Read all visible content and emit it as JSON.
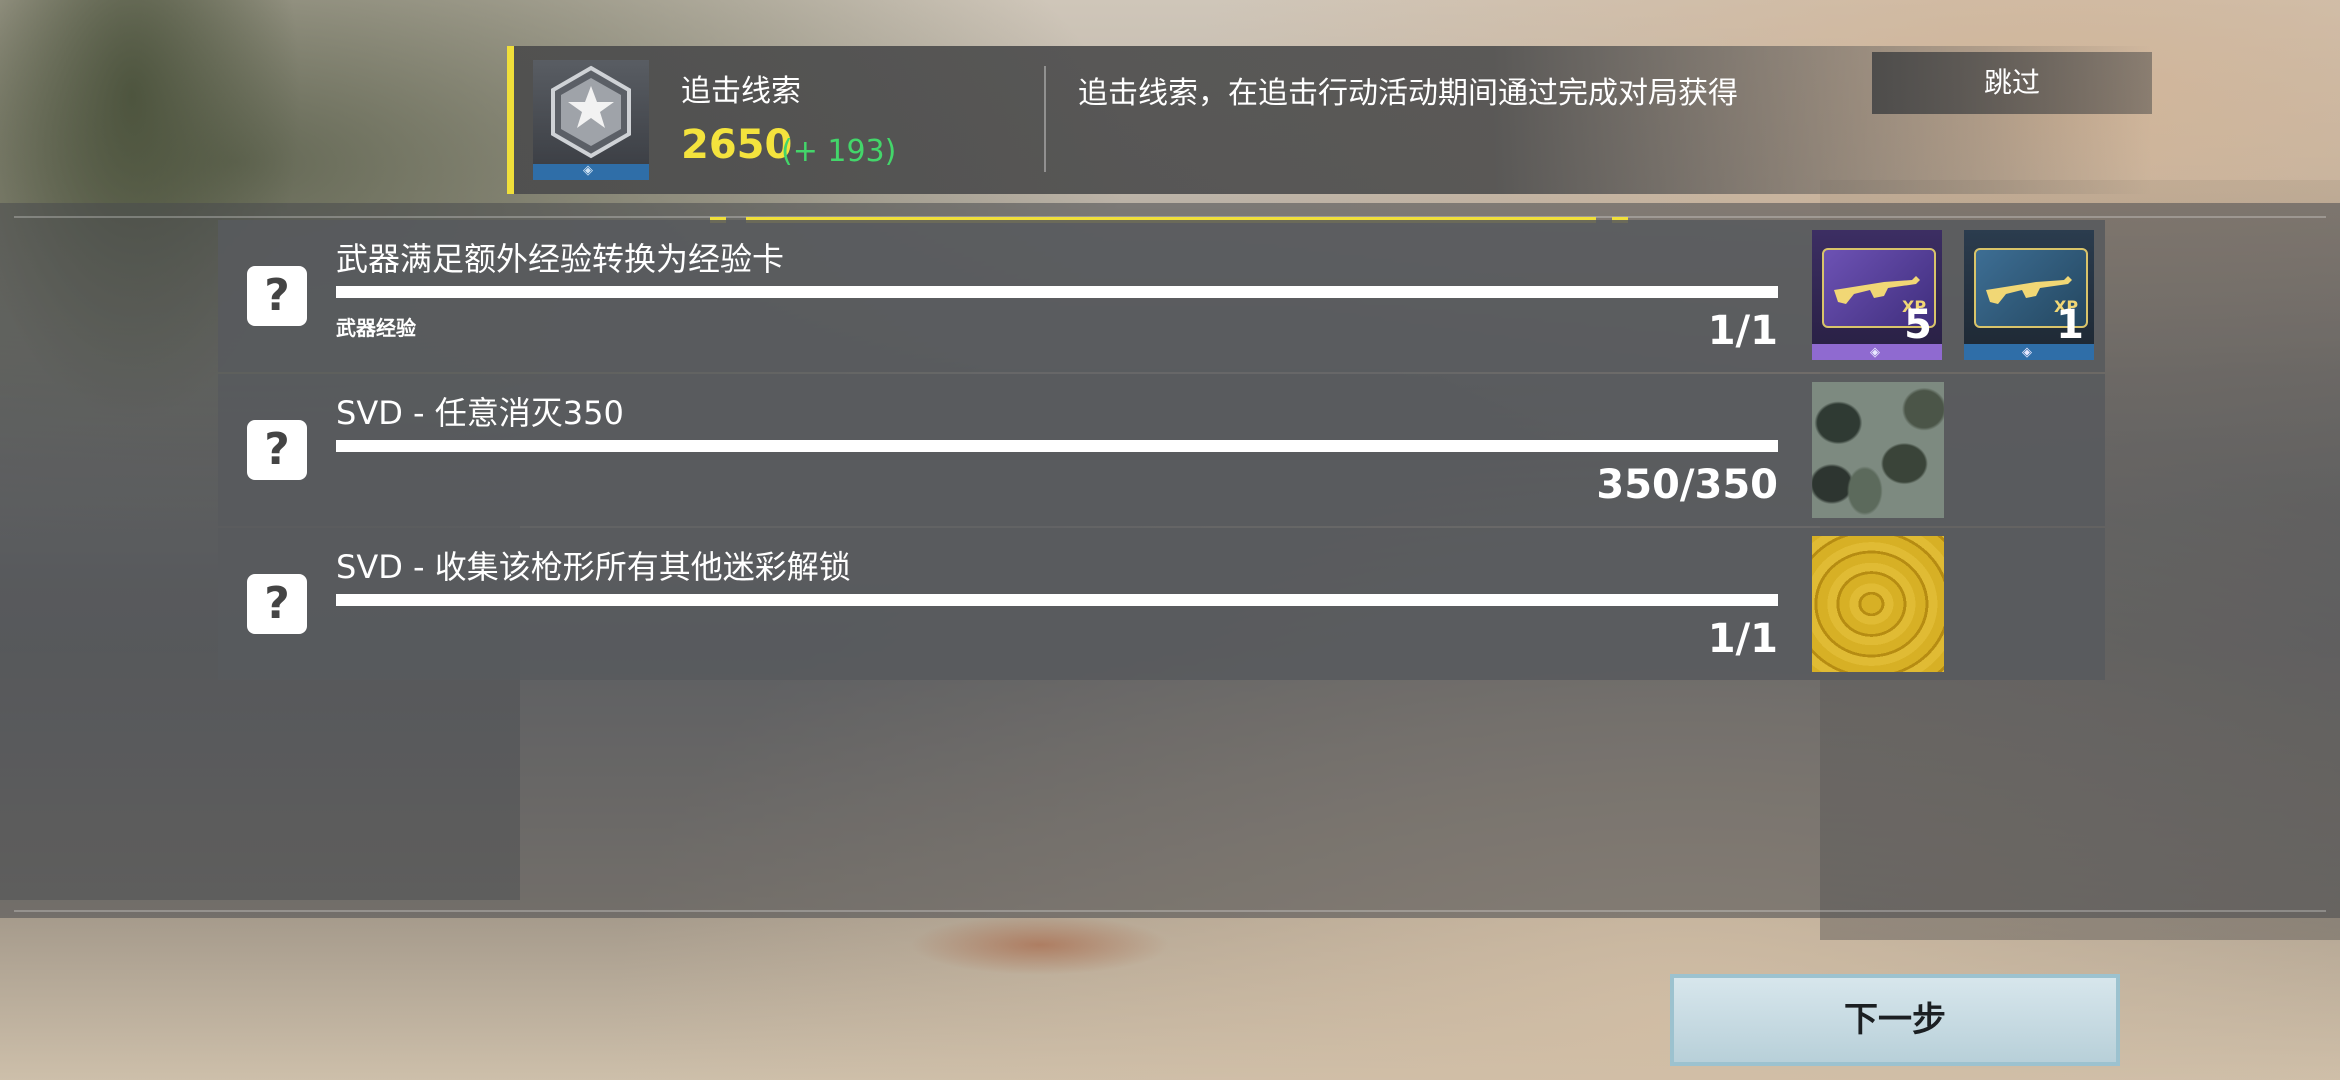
{
  "header": {
    "title": "追击线索",
    "score": "2650",
    "gain": "(+ 193)",
    "description": "追击线索，在追击行动活动期间通过完成对局获得",
    "skip_label": "跳过"
  },
  "tasks": [
    {
      "title": "武器满足额外经验转换为经验卡",
      "subtitle": "武器经验",
      "count": "1/1",
      "rewards": [
        {
          "type": "xp-card-purple",
          "icon": "rifle-xp-card",
          "quantity": "5"
        },
        {
          "type": "xp-card-blue",
          "icon": "rifle-xp-card",
          "quantity": "1"
        }
      ]
    },
    {
      "title": "SVD - 任意消灭350",
      "subtitle": "",
      "count": "350/350",
      "rewards": [
        {
          "type": "camo",
          "icon": "woodland-camo"
        }
      ]
    },
    {
      "title": "SVD - 收集该枪形所有其他迷彩解锁",
      "subtitle": "",
      "count": "1/1",
      "rewards": [
        {
          "type": "camo",
          "icon": "gold-camo"
        }
      ]
    }
  ],
  "next_label": "下一步",
  "colors": {
    "accent_yellow": "#f0df3a",
    "gain_green": "#43d66a",
    "rarity_purple": "#8f6ad0",
    "rarity_blue": "#2f6ea8"
  }
}
